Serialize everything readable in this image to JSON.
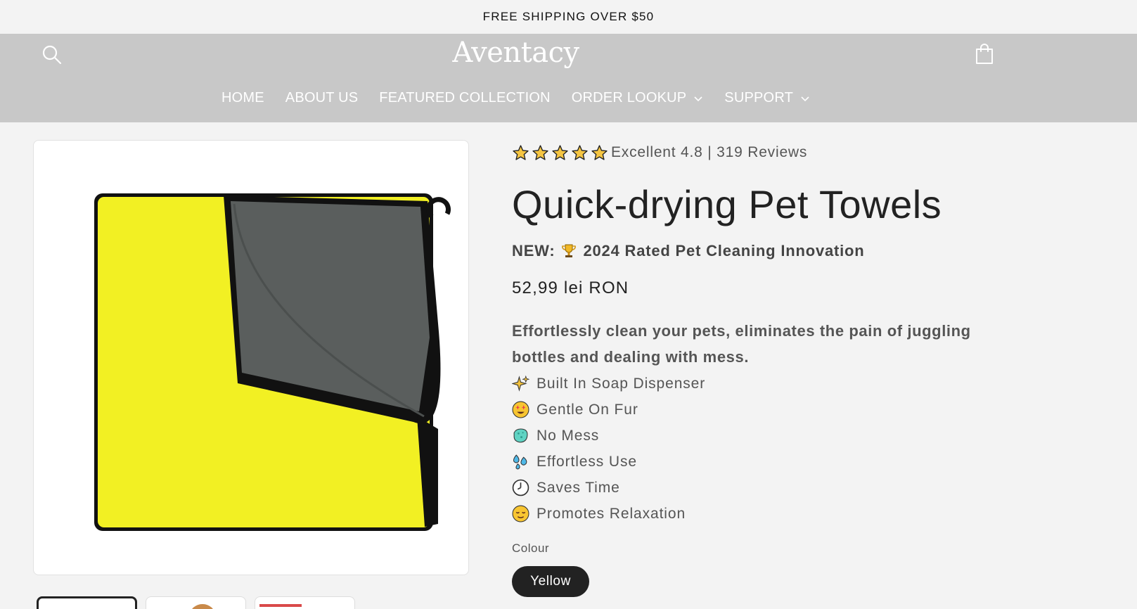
{
  "announcement": {
    "text": "FREE SHIPPING OVER $50"
  },
  "header": {
    "logo": "Aventacy",
    "nav": [
      {
        "label": "HOME",
        "has_dropdown": false
      },
      {
        "label": "ABOUT US",
        "has_dropdown": false
      },
      {
        "label": "FEATURED COLLECTION",
        "has_dropdown": false
      },
      {
        "label": "ORDER LOOKUP",
        "has_dropdown": true
      },
      {
        "label": "SUPPORT",
        "has_dropdown": true
      }
    ],
    "icons": {
      "search": "search-icon",
      "cart": "cart-icon"
    }
  },
  "product": {
    "rating": {
      "stars": 5,
      "text": "Excellent 4.8 | 319 Reviews"
    },
    "title": "Quick-drying Pet Towels",
    "badge": {
      "prefix": "NEW:",
      "icon": "trophy-icon",
      "text": "2024 Rated Pet Cleaning Innovation"
    },
    "price": "52,99 lei RON",
    "description": "Effortlessly clean your pets, eliminates the pain of juggling bottles and dealing with mess.",
    "features": [
      {
        "icon": "sparkles-icon",
        "label": "Built In Soap Dispenser"
      },
      {
        "icon": "star-struck-face-icon",
        "label": "Gentle On Fur"
      },
      {
        "icon": "sponge-icon",
        "label": "No Mess"
      },
      {
        "icon": "droplets-icon",
        "label": "Effortless Use"
      },
      {
        "icon": "clock-icon",
        "label": "Saves Time"
      },
      {
        "icon": "relieved-face-icon",
        "label": "Promotes Relaxation"
      }
    ],
    "colour": {
      "label": "Colour",
      "selected": "Yellow"
    }
  },
  "gallery": {
    "active_thumbnail": 1,
    "thumbnail_count": 3
  },
  "colors": {
    "header_bg": "#c8c8c8",
    "page_bg": "#f3f3f3",
    "towel_yellow": "#f2f023",
    "towel_gray": "#5a5e5d",
    "swatch_bg": "#222222"
  }
}
